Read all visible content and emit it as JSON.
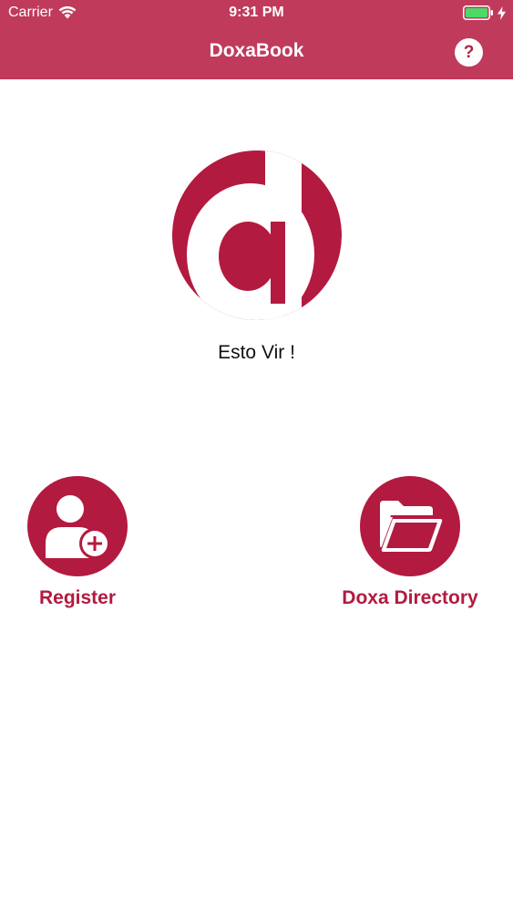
{
  "status_bar": {
    "carrier": "Carrier",
    "time": "9:31 PM",
    "icons": [
      "wifi-icon",
      "battery-icon",
      "charging-bolt-icon"
    ]
  },
  "nav": {
    "title": "DoxaBook",
    "help_label": "?",
    "help_icon": "help-icon"
  },
  "logo": {
    "icon": "doxa-d-logo"
  },
  "tagline": "Esto Vir !",
  "actions": {
    "register": {
      "label": "Register",
      "icon": "add-user-icon"
    },
    "directory": {
      "label": "Doxa Directory",
      "icon": "folder-open-icon"
    }
  },
  "colors": {
    "header": "#c03a5c",
    "brand": "#b31a3f",
    "battery": "#4cd964"
  }
}
